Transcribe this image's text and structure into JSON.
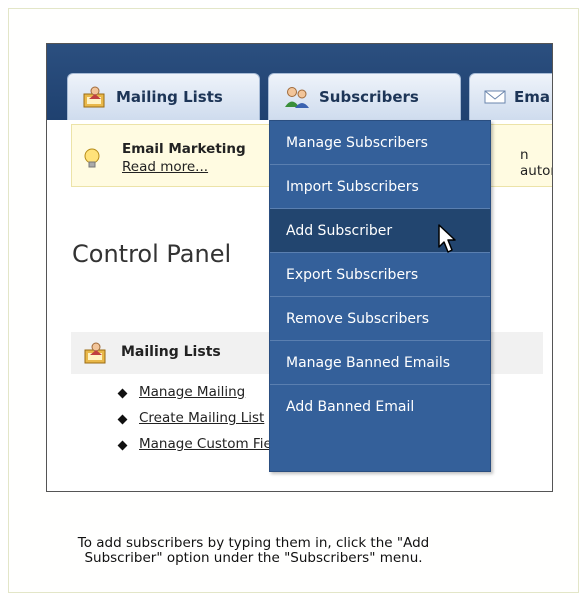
{
  "tabs": {
    "mailing_lists": "Mailing Lists",
    "subscribers": "Subscribers",
    "email_truncated": "Ema"
  },
  "notice": {
    "title": "Email Marketing",
    "read_more": "Read more...",
    "trailing": "n autores"
  },
  "control_panel_title": "Control Panel",
  "mailing_lists_section": {
    "title": "Mailing Lists",
    "links": [
      "Manage Mailing",
      "Create Mailing List",
      "Manage Custom Fields"
    ]
  },
  "dropdown": {
    "items": [
      "Manage Subscribers",
      "Import Subscribers",
      "Add Subscriber",
      "Export Subscribers",
      "Remove Subscribers",
      "Manage Banned Emails",
      "Add Banned Email"
    ],
    "active_index": 2
  },
  "caption": {
    "line1": "To add subscribers by typing them in, click the \"Add",
    "line2": "Subscriber\" option under the \"Subscribers\" menu."
  },
  "colors": {
    "nav_bg": "#1f4170",
    "dropdown_bg": "#34609a",
    "dropdown_active": "#22456f",
    "notice_bg": "#fffbe1"
  }
}
